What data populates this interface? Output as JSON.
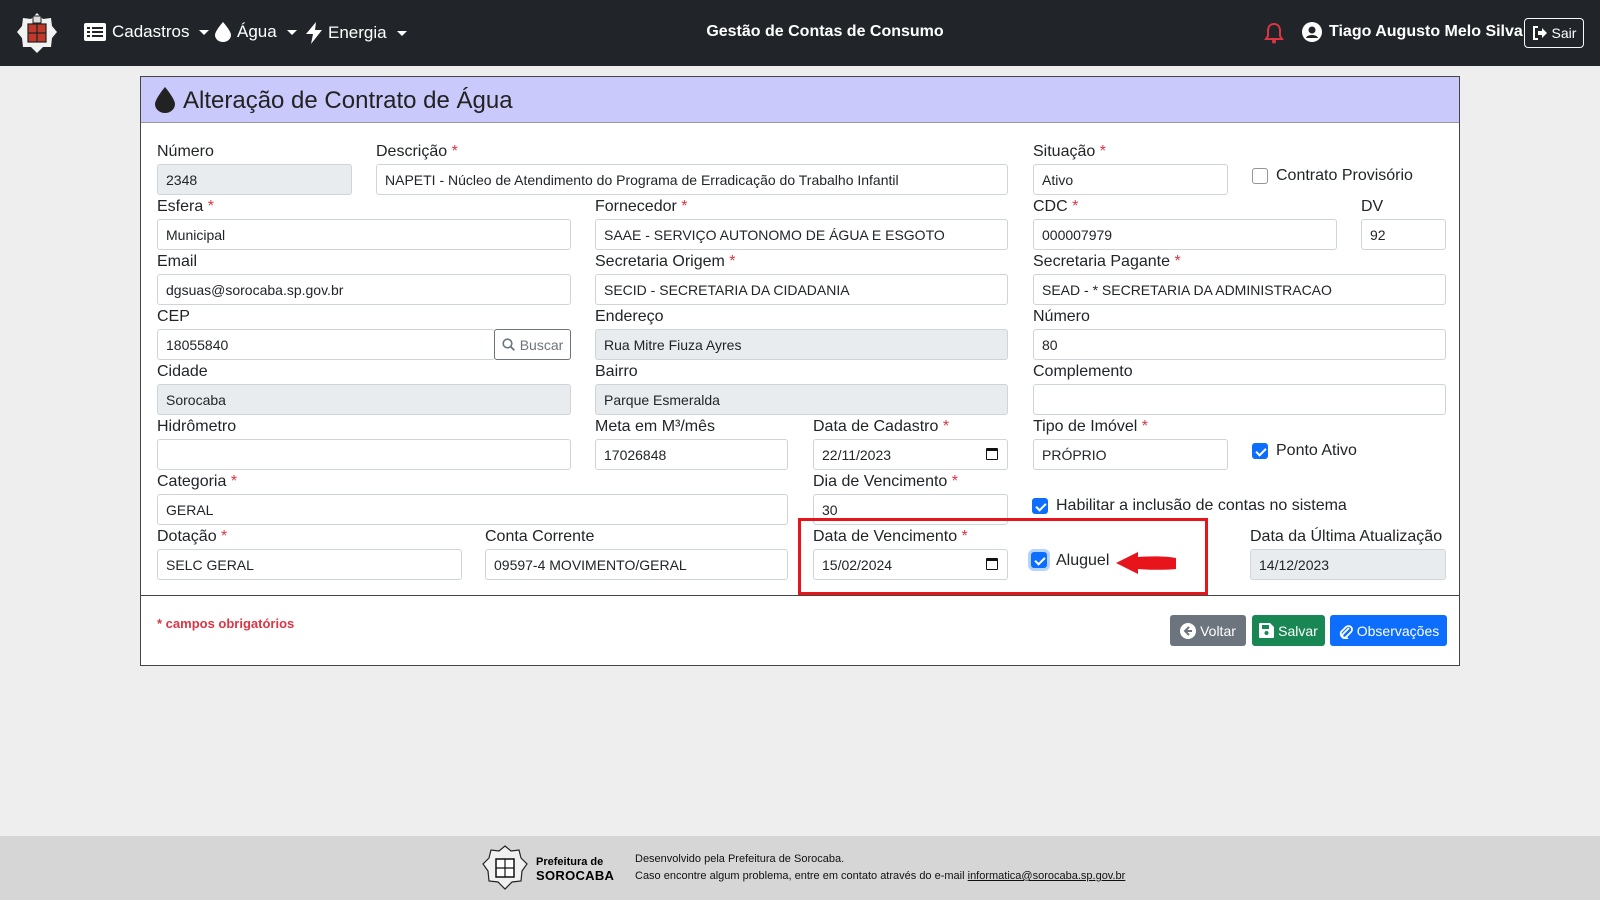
{
  "navbar": {
    "menu_cadastros": "Cadastros",
    "menu_agua": "Água",
    "menu_energia": "Energia",
    "app_title": "Gestão de Contas de Consumo",
    "user_name": "Tiago Augusto Melo Silva",
    "logout_label": "Sair"
  },
  "page": {
    "title": "Alteração de Contrato de Água"
  },
  "form": {
    "numero": {
      "label": "Número",
      "value": "2348"
    },
    "descricao": {
      "label": "Descrição",
      "value": "NAPETI - Núcleo de Atendimento do Programa de Erradicação do Trabalho Infantil"
    },
    "situacao": {
      "label": "Situação",
      "value": "Ativo"
    },
    "contrato_provisorio": {
      "label": "Contrato Provisório",
      "checked": false
    },
    "esfera": {
      "label": "Esfera",
      "value": "Municipal"
    },
    "fornecedor": {
      "label": "Fornecedor",
      "value": "SAAE - SERVIÇO AUTONOMO DE ÁGUA E ESGOTO"
    },
    "cdc": {
      "label": "CDC",
      "value": "000007979"
    },
    "dv": {
      "label": "DV",
      "value": "92"
    },
    "email": {
      "label": "Email",
      "value": "dgsuas@sorocaba.sp.gov.br"
    },
    "secretaria_origem": {
      "label": "Secretaria Origem",
      "value": "SECID - SECRETARIA DA CIDADANIA"
    },
    "secretaria_pagante": {
      "label": "Secretaria Pagante",
      "value": "SEAD - * SECRETARIA DA ADMINISTRACAO"
    },
    "cep": {
      "label": "CEP",
      "value": "18055840",
      "search_label": "Buscar"
    },
    "endereco": {
      "label": "Endereço",
      "value": "Rua Mitre Fiuza Ayres"
    },
    "numero_end": {
      "label": "Número",
      "value": "80"
    },
    "cidade": {
      "label": "Cidade",
      "value": "Sorocaba"
    },
    "bairro": {
      "label": "Bairro",
      "value": "Parque Esmeralda"
    },
    "complemento": {
      "label": "Complemento",
      "value": ""
    },
    "hidrometro": {
      "label": "Hidrômetro",
      "value": ""
    },
    "meta": {
      "label": "Meta em M³/mês",
      "value": "17026848"
    },
    "data_cadastro": {
      "label": "Data de Cadastro",
      "value": "22/11/2023"
    },
    "tipo_imovel": {
      "label": "Tipo de Imóvel",
      "value": "PRÓPRIO"
    },
    "ponto_ativo": {
      "label": "Ponto Ativo",
      "checked": true
    },
    "categoria": {
      "label": "Categoria",
      "value": "GERAL"
    },
    "dia_vencimento": {
      "label": "Dia de Vencimento",
      "value": "30"
    },
    "habilitar": {
      "label": "Habilitar a inclusão de contas no sistema",
      "checked": true
    },
    "dotacao": {
      "label": "Dotação",
      "value": "SELC GERAL"
    },
    "conta_corrente": {
      "label": "Conta Corrente",
      "value": "09597-4 MOVIMENTO/GERAL"
    },
    "data_vencimento": {
      "label": "Data de Vencimento",
      "value": "15/02/2024"
    },
    "aluguel": {
      "label": "Aluguel",
      "checked": true
    },
    "ultima_atualizacao": {
      "label": "Data da Última Atualização",
      "value": "14/12/2023"
    },
    "required_mark": "*"
  },
  "footer_actions": {
    "required_note": "* campos obrigatórios",
    "voltar": "Voltar",
    "salvar": "Salvar",
    "observacoes": "Observações"
  },
  "footer": {
    "brand_line1": "Prefeitura de",
    "brand_line2": "SOROCABA",
    "line1": "Desenvolvido pela Prefeitura de Sorocaba.",
    "line2_prefix": "Caso encontre algum problema, entre em contato através do e-mail ",
    "email": "informatica@sorocaba.sp.gov.br"
  },
  "colors": {
    "navbar": "#212529",
    "header": "#c9c9fb",
    "primary": "#0d6efd",
    "success": "#198754",
    "secondary": "#6c757d",
    "danger": "#dc3545",
    "highlight": "#e8141b"
  }
}
